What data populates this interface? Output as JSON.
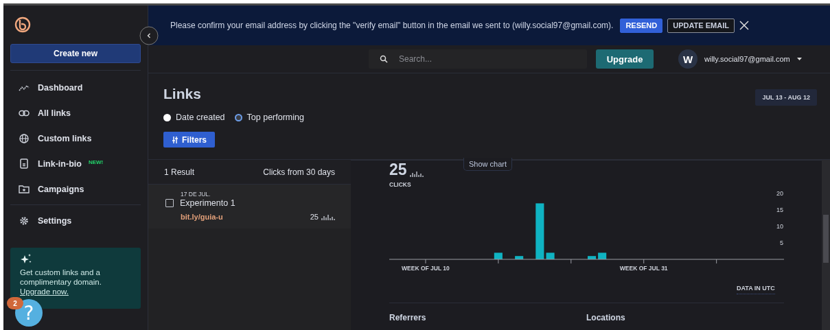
{
  "sidebar": {
    "create_button": "Create new",
    "nav": [
      {
        "label": "Dashboard",
        "kind": "dashboard"
      },
      {
        "label": "All links",
        "kind": "links"
      },
      {
        "label": "Custom links",
        "kind": "globe"
      },
      {
        "label": "Link-in-bio",
        "kind": "bio",
        "badge": "NEW!"
      },
      {
        "label": "Campaigns",
        "kind": "campaigns"
      },
      {
        "label": "Settings",
        "kind": "settings"
      }
    ],
    "promo": {
      "text": "Get custom links and a complimentary domain.",
      "link": "Upgrade now."
    },
    "help": {
      "label": "?",
      "badge": "2"
    }
  },
  "banner": {
    "message": "Please confirm your email address by clicking the \"verify email\" button in the email we sent to (willy.social97@gmail.com).",
    "buttons": [
      {
        "label": "RESEND",
        "kind": "primary"
      },
      {
        "label": "UPDATE EMAIL",
        "kind": "outline"
      }
    ]
  },
  "topbar": {
    "search": {
      "placeholder": "Search..."
    },
    "upgrade": "Upgrade",
    "account": {
      "initial": "W",
      "email": "willy.social97@gmail.com"
    }
  },
  "page": {
    "title": "Links",
    "date_range": "JUL 13 - AUG 12",
    "sort_options": [
      {
        "label": "Date created",
        "selected": false
      },
      {
        "label": "Top performing",
        "selected": true
      }
    ],
    "filters": "Filters"
  },
  "results": {
    "count": "1 Result",
    "clicks_heading": "Clicks from 30 days",
    "rows": [
      {
        "date": "17 DE JUL.",
        "title": "Experimento 1",
        "checked": false,
        "short_link": "bit.ly/guia-u",
        "clicks": "25"
      }
    ]
  },
  "stats": {
    "total": "25",
    "total_label": "CLICKS",
    "toggle": "Show chart",
    "note": "DATA IN UTC",
    "sections": [
      "Referrers",
      "Locations"
    ],
    "chart_data": {
      "type": "bar",
      "categories": [
        null,
        null,
        null,
        "WEEK OF JUL 10",
        null,
        null,
        null,
        null,
        null,
        null,
        null,
        null,
        null,
        null,
        null,
        null,
        null,
        null,
        null,
        null,
        null,
        null,
        null,
        null,
        "WEEK OF JUL 31",
        null,
        null,
        null,
        null,
        null,
        null,
        null,
        null,
        null,
        null,
        null,
        null,
        null
      ],
      "values": [
        0,
        0,
        0,
        0,
        0,
        0,
        0,
        0,
        0,
        0,
        2,
        0,
        1,
        0,
        17,
        2,
        0,
        0,
        0,
        1,
        2,
        0,
        0,
        0,
        0,
        0,
        0,
        0,
        0,
        0,
        0,
        0,
        0,
        0,
        0,
        0,
        0,
        0
      ],
      "ylim": [
        0,
        20
      ],
      "yticks": [
        5,
        10,
        15,
        20
      ]
    }
  }
}
